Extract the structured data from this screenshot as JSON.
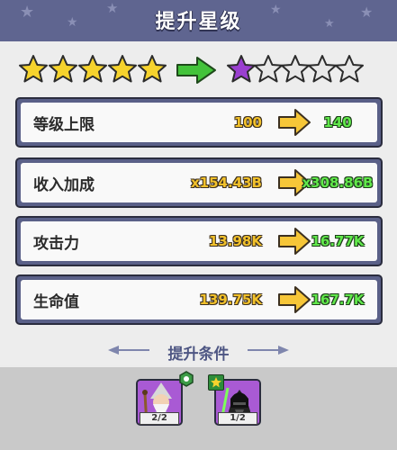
{
  "header": {
    "title": "提升星级"
  },
  "stars": {
    "current_filled": 5,
    "current_total": 5,
    "next_filled": 1,
    "next_total": 5,
    "colors": {
      "gold": "#f6d32d",
      "purple": "#9a3fd0",
      "empty": "#e8e8e8",
      "arrow": "#43c33a"
    }
  },
  "stats": [
    {
      "label": "等级上限",
      "from": "100",
      "to": "140"
    },
    {
      "label": "收入加成",
      "from": "x154.43B",
      "to": "x308.86B"
    },
    {
      "label": "攻击力",
      "from": "13.98K",
      "to": "16.77K"
    },
    {
      "label": "生命值",
      "from": "139.75K",
      "to": "167.7K"
    }
  ],
  "conditions": {
    "title": "提升条件",
    "items": [
      {
        "name": "wizard",
        "count": "2/2",
        "badge": "hexagon-icon"
      },
      {
        "name": "dark-knight",
        "count": "1/2",
        "badge": "star-badge-icon"
      }
    ]
  }
}
